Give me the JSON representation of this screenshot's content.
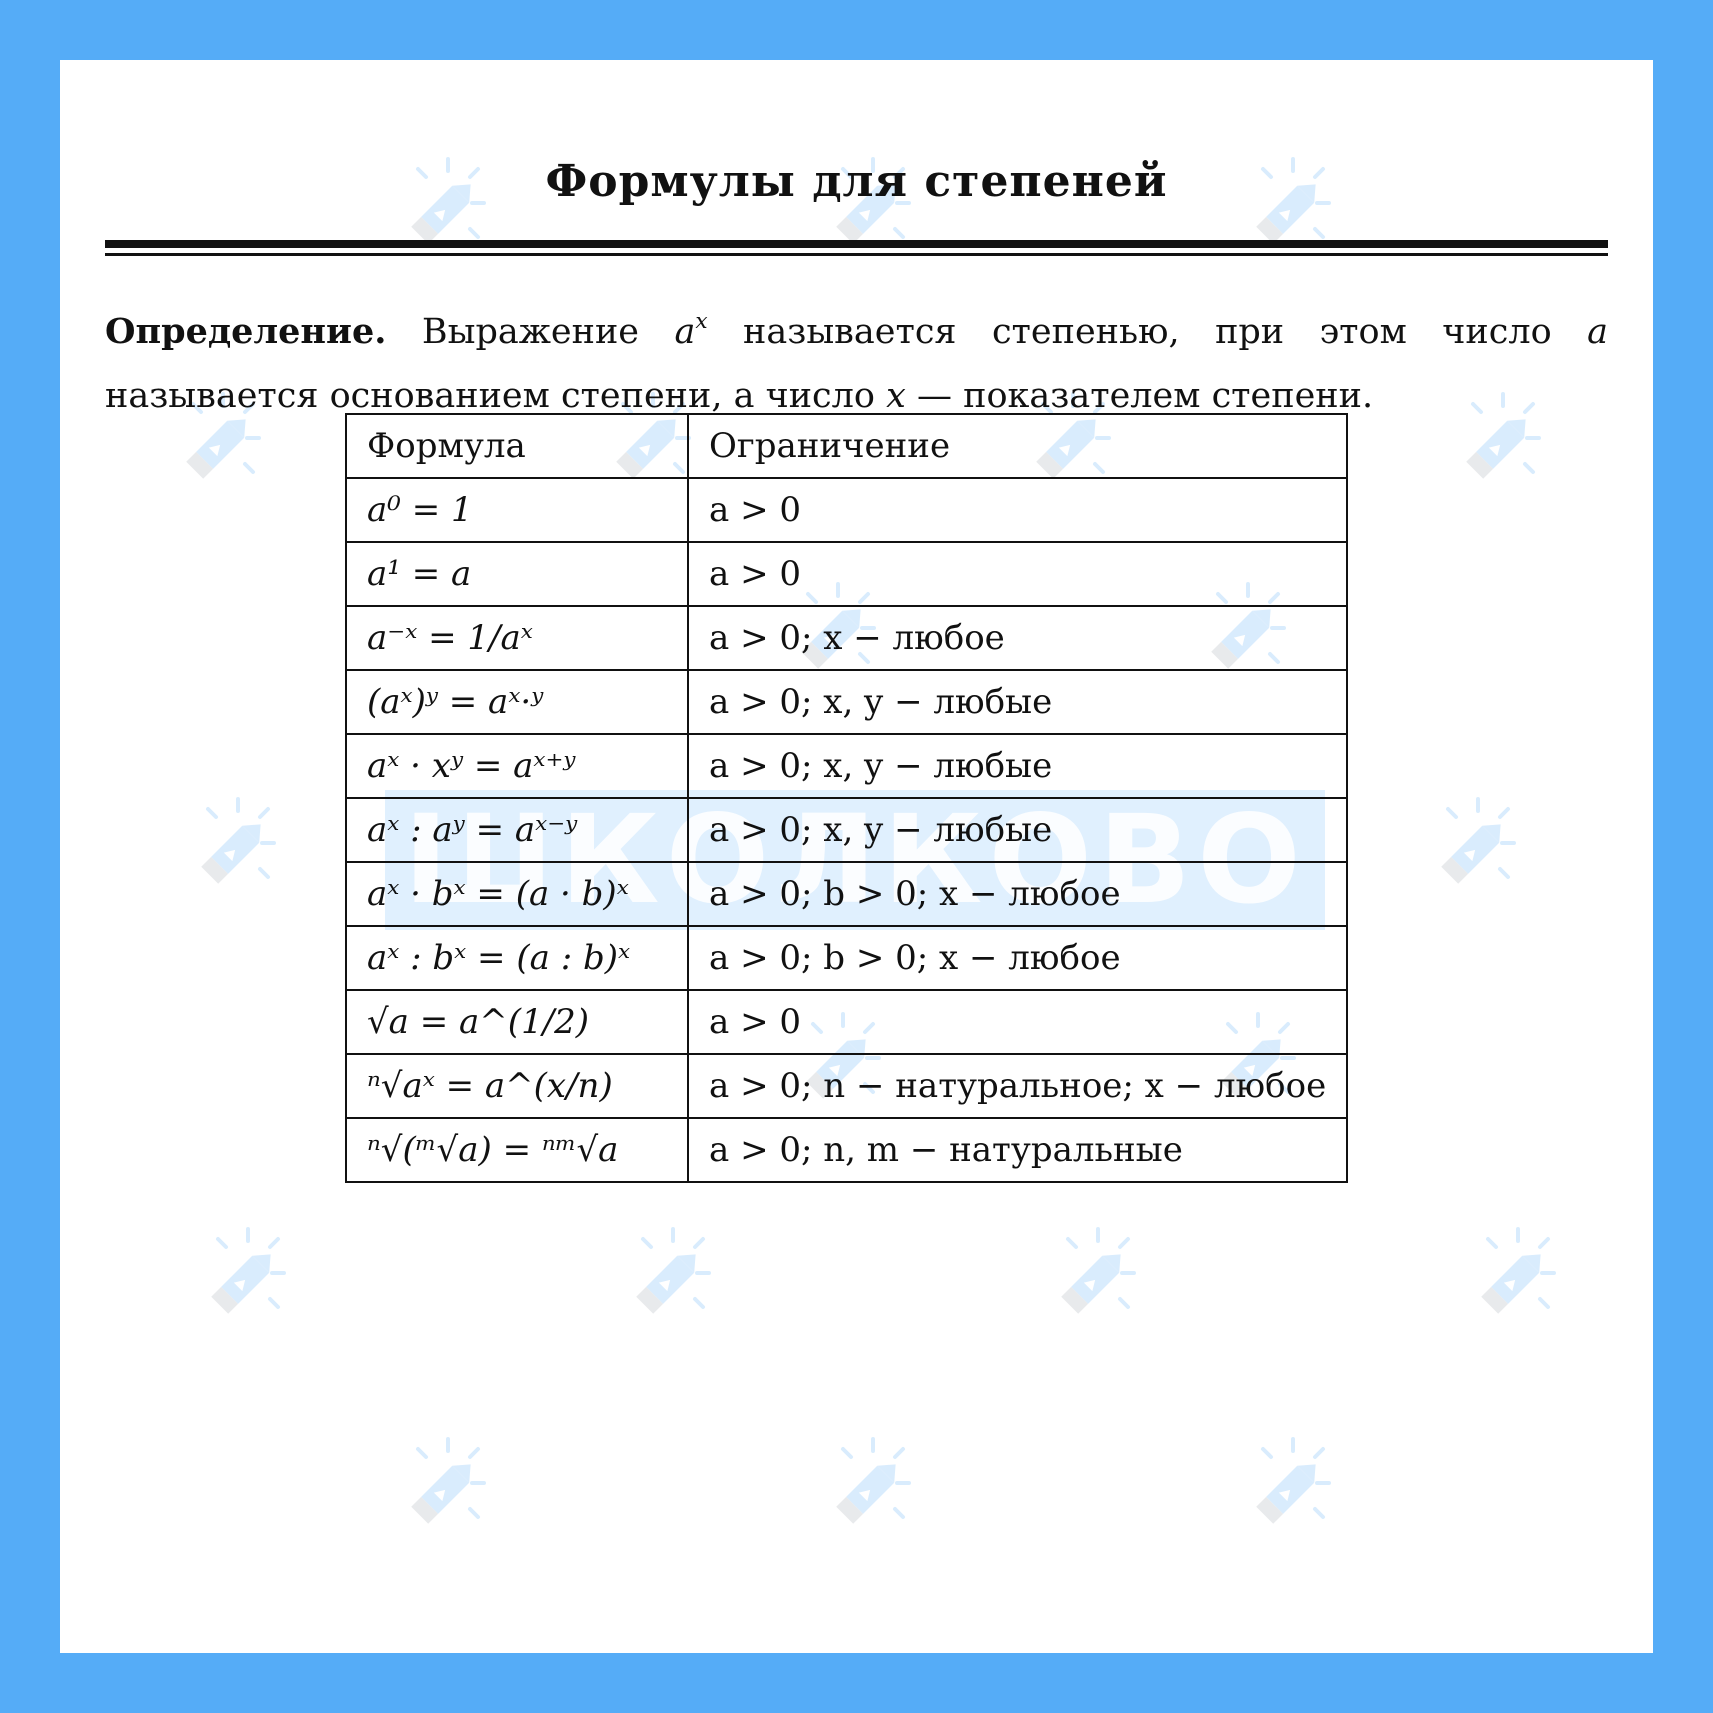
{
  "title": "Формулы для степеней",
  "definition": {
    "label": "Определение.",
    "text_1": "Выражение",
    "expr": "a",
    "expr_sup": "x",
    "text_2": "называется степенью, при этом число",
    "base_var": "a",
    "text_3": "называется основанием степени, а число",
    "exp_var": "x",
    "text_4": "— показателем степени."
  },
  "table": {
    "headers": [
      "Формула",
      "Ограничение"
    ],
    "rows": [
      {
        "formula": "a⁰ = 1",
        "restriction": "a > 0"
      },
      {
        "formula": "a¹ = a",
        "restriction": "a > 0"
      },
      {
        "formula": "a⁻ˣ = 1/aˣ",
        "restriction": "a > 0; x − любое"
      },
      {
        "formula": "(aˣ)ʸ = aˣ·ʸ",
        "restriction": "a > 0; x, y − любые"
      },
      {
        "formula": "aˣ · xʸ = aˣ⁺ʸ",
        "restriction": "a > 0; x, y − любые"
      },
      {
        "formula": "aˣ : aʸ = aˣ⁻ʸ",
        "restriction": "a > 0; x, y − любые"
      },
      {
        "formula": "aˣ · bˣ = (a · b)ˣ",
        "restriction": "a > 0; b > 0; x − любое"
      },
      {
        "formula": "aˣ : bˣ = (a : b)ˣ",
        "restriction": "a > 0; b > 0; x − любое"
      },
      {
        "formula": "√a = a^(1/2)",
        "restriction": "a > 0"
      },
      {
        "formula": "ⁿ√aˣ = a^(x/n)",
        "restriction": "a > 0; n − натуральное; x − любое"
      },
      {
        "formula": "ⁿ√(ᵐ√a) = ⁿᵐ√a",
        "restriction": "a > 0; n, m − натуральные"
      }
    ]
  },
  "watermark": {
    "word": "ШКОЛКОВО",
    "icon": "pencil-logo-icon",
    "color": "#55acf7"
  },
  "colors": {
    "frame": "#55acf7",
    "sheet": "#ffffff",
    "text": "#111111"
  }
}
